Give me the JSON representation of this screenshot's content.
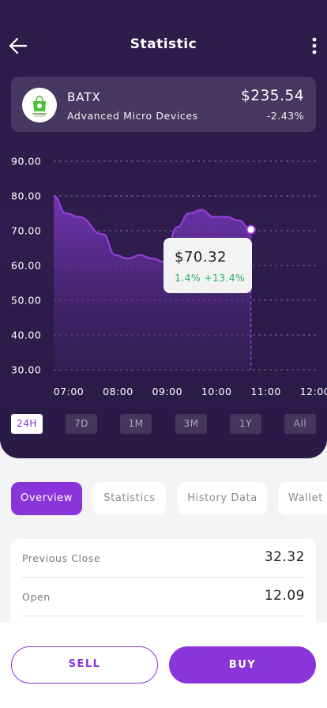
{
  "header": {
    "title": "Statistic",
    "back_icon": "arrow-left-icon",
    "menu_icon": "more-vertical-icon"
  },
  "stock": {
    "ticker": "BATX",
    "company": "Advanced Micro Devices",
    "price": "$235.54",
    "change": "-2.43%",
    "logo_icon": "shopping-bag-logo-icon"
  },
  "chart_data": {
    "type": "area",
    "x": [
      "07:00",
      "07:15",
      "07:30",
      "08:00",
      "08:15",
      "08:30",
      "08:45",
      "09:00",
      "09:15",
      "09:30",
      "09:45",
      "10:00",
      "10:15",
      "10:30",
      "10:45",
      "11:00"
    ],
    "xticks": [
      "07:00",
      "08:00",
      "09:00",
      "10:00",
      "11:00",
      "12:00"
    ],
    "values": [
      80,
      75,
      74,
      69,
      63,
      62,
      63,
      62,
      61,
      71,
      75,
      76,
      74,
      74,
      73,
      70.32
    ],
    "ylim": [
      30,
      90
    ],
    "yticks": [
      "90.00",
      "80.00",
      "70.00",
      "60.00",
      "50.00",
      "40.00",
      "30.00"
    ],
    "grid": true,
    "color": "#9140d8",
    "highlight": {
      "x": "11:00",
      "value": "$70.32",
      "change": "1.4% +13.4%"
    }
  },
  "ranges": [
    "24H",
    "7D",
    "1M",
    "3M",
    "1Y",
    "All"
  ],
  "active_range": "24H",
  "tabs": [
    "Overview",
    "Statistics",
    "History Data",
    "Wallet"
  ],
  "active_tab": "Overview",
  "overview": [
    {
      "label": "Previous Close",
      "value": "32.32"
    },
    {
      "label": "Open",
      "value": "12.09"
    }
  ],
  "actions": {
    "sell": "SELL",
    "buy": "BUY"
  },
  "colors": {
    "accent": "#8a35d9",
    "hero_bg": "#2c1c4a",
    "positive": "#2eaa6a"
  }
}
